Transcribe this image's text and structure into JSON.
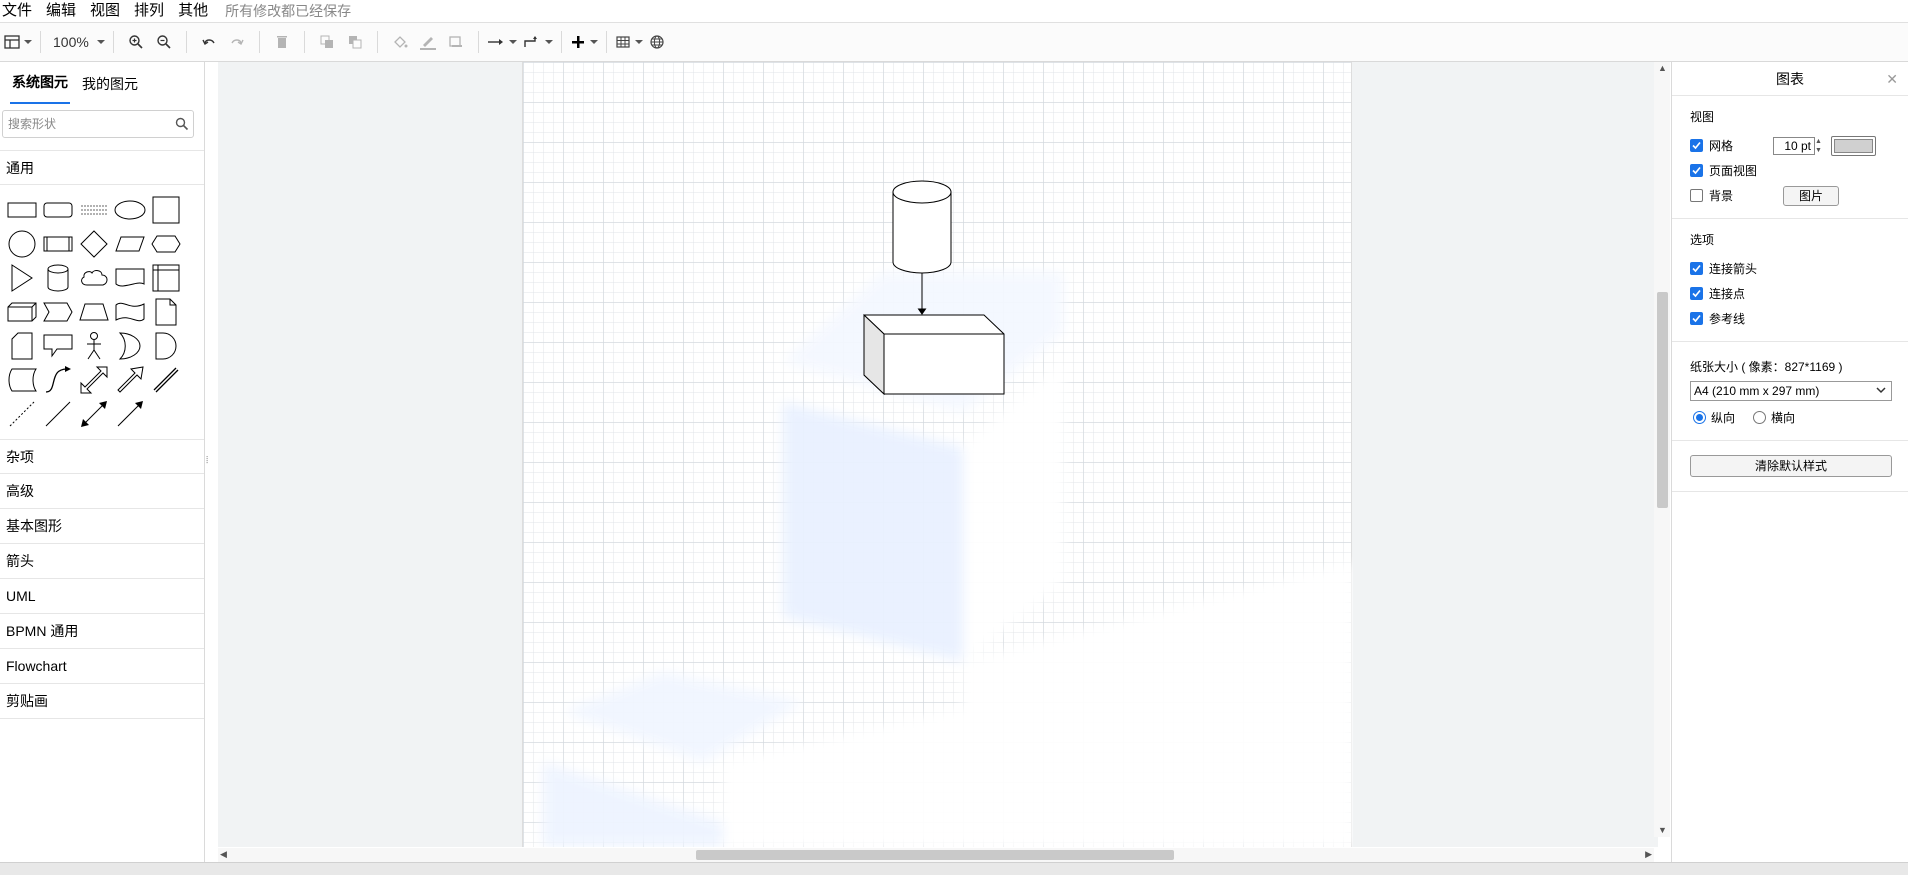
{
  "menubar": {
    "items": [
      "文件",
      "编辑",
      "视图",
      "排列",
      "其他"
    ],
    "save_status": "所有修改都已经保存"
  },
  "toolbar": {
    "zoom": "100%"
  },
  "sidebar": {
    "tabs": [
      "系统图元",
      "我的图元"
    ],
    "search_placeholder": "搜索形状",
    "sections": [
      "通用",
      "杂项",
      "高级",
      "基本图形",
      "箭头",
      "UML",
      "BPMN 通用",
      "Flowchart",
      "剪贴画"
    ]
  },
  "panel": {
    "title": "图表",
    "view_title": "视图",
    "grid_label": "网格",
    "grid_size": "10 pt",
    "page_view_label": "页面视图",
    "background_label": "背景",
    "image_button": "图片",
    "options_title": "选项",
    "connection_arrows": "连接箭头",
    "connection_points": "连接点",
    "guides": "参考线",
    "paper_size_label": "纸张大小 ( 像素：827*1169 )",
    "paper_size_value": "A4 (210 mm x 297 mm)",
    "portrait": "纵向",
    "landscape": "横向",
    "clear_styles": "清除默认样式"
  },
  "colors": {
    "accent": "#1a73e8",
    "grid_color_swatch": "#d0d0d0",
    "canvas_bg": "#f1f3f4"
  }
}
